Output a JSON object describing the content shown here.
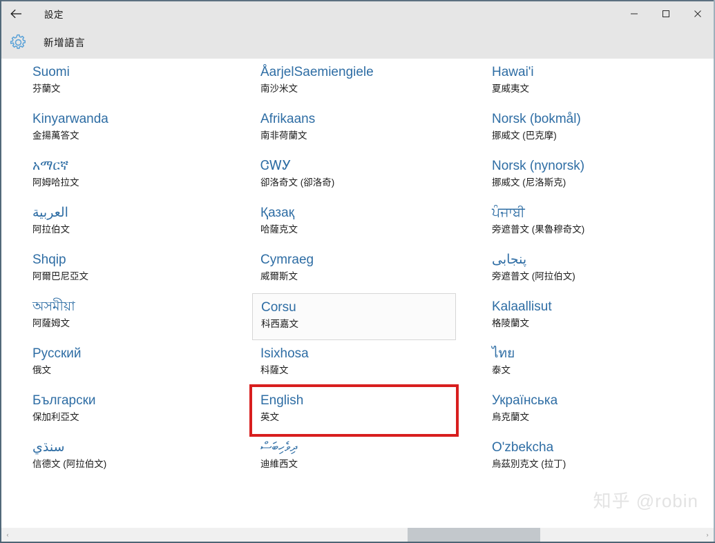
{
  "window": {
    "titlebar_title": "設定",
    "back_icon": "back-arrow-icon",
    "minimize_label": "—",
    "maximize_label": "☐",
    "close_label": "✕"
  },
  "header": {
    "gear_icon": "gear-icon",
    "page_title": "新增語言"
  },
  "colors": {
    "language_native": "#2e6da4",
    "annotation_red": "#d81e1e",
    "header_bg": "#e6e6e6",
    "hover_border": "#d6d6d6",
    "scroll_thumb": "#c3c8cc"
  },
  "columns": [
    {
      "items": [
        {
          "native": "Suomi",
          "translation": "芬蘭文",
          "rtl": false,
          "state": "normal"
        },
        {
          "native": "Kinyarwanda",
          "translation": "金揚萬答文",
          "rtl": false,
          "state": "normal"
        },
        {
          "native": "አማርኛ",
          "translation": "阿姆哈拉文",
          "rtl": false,
          "state": "normal"
        },
        {
          "native": "العربية",
          "translation": "阿拉伯文",
          "rtl": true,
          "state": "normal"
        },
        {
          "native": "Shqip",
          "translation": "阿爾巴尼亞文",
          "rtl": false,
          "state": "normal"
        },
        {
          "native": "অসমীয়া",
          "translation": "阿薩姆文",
          "rtl": false,
          "state": "normal"
        },
        {
          "native": "Русский",
          "translation": "俄文",
          "rtl": false,
          "state": "normal"
        },
        {
          "native": "Български",
          "translation": "保加利亞文",
          "rtl": false,
          "state": "normal"
        },
        {
          "native": "سنڌي",
          "translation": "信德文 (阿拉伯文)",
          "rtl": true,
          "state": "normal"
        }
      ]
    },
    {
      "items": [
        {
          "native": "ÅarjelSaemiengiele",
          "translation": "南沙米文",
          "rtl": false,
          "state": "normal"
        },
        {
          "native": "Afrikaans",
          "translation": "南非荷蘭文",
          "rtl": false,
          "state": "normal"
        },
        {
          "native": "ᏣᎳᎩ",
          "translation": "卻洛奇文 (卻洛奇)",
          "rtl": false,
          "state": "normal"
        },
        {
          "native": "Қазақ",
          "translation": "哈薩克文",
          "rtl": false,
          "state": "normal"
        },
        {
          "native": "Cymraeg",
          "translation": "威爾斯文",
          "rtl": false,
          "state": "normal"
        },
        {
          "native": "Corsu",
          "translation": "科西嘉文",
          "rtl": false,
          "state": "hovered"
        },
        {
          "native": "Isixhosa",
          "translation": "科薩文",
          "rtl": false,
          "state": "normal"
        },
        {
          "native": "English",
          "translation": "英文",
          "rtl": false,
          "state": "annotated"
        },
        {
          "native": "ދިވެހިބަސް",
          "translation": "迪維西文",
          "rtl": true,
          "state": "normal"
        }
      ]
    },
    {
      "items": [
        {
          "native": "Hawai'i",
          "translation": "夏威夷文",
          "rtl": false,
          "state": "normal"
        },
        {
          "native": "Norsk (bokmål)",
          "translation": "挪威文 (巴克摩)",
          "rtl": false,
          "state": "normal"
        },
        {
          "native": "Norsk (nynorsk)",
          "translation": "挪威文 (尼洛斯克)",
          "rtl": false,
          "state": "normal"
        },
        {
          "native": "ਪੰਜਾਬੀ",
          "translation": "旁遮普文 (果魯穆奇文)",
          "rtl": false,
          "state": "normal"
        },
        {
          "native": "پنجابی",
          "translation": "旁遮普文 (阿拉伯文)",
          "rtl": true,
          "state": "normal"
        },
        {
          "native": "Kalaallisut",
          "translation": "格陵蘭文",
          "rtl": false,
          "state": "normal"
        },
        {
          "native": "ไทย",
          "translation": "泰文",
          "rtl": false,
          "state": "normal"
        },
        {
          "native": "Українська",
          "translation": "烏克蘭文",
          "rtl": false,
          "state": "normal"
        },
        {
          "native": "O'zbekcha",
          "translation": "烏茲別克文 (拉丁)",
          "rtl": false,
          "state": "normal"
        }
      ]
    }
  ],
  "watermark": {
    "text": "知乎 @robin"
  },
  "scrollbar": {
    "left_arrow": "‹",
    "right_arrow": "›"
  }
}
